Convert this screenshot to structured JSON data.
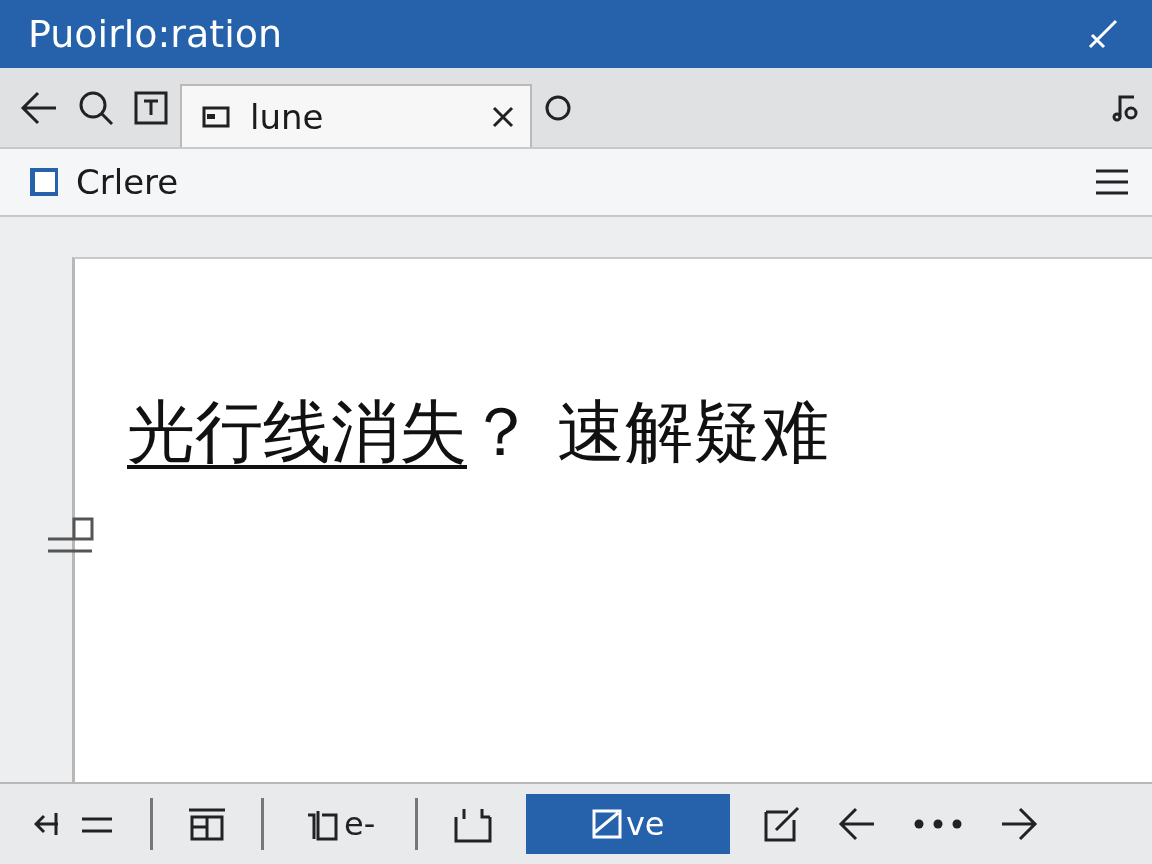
{
  "window": {
    "title": "Puoirlo:ration"
  },
  "tabs": [
    {
      "label": "lune",
      "selected": true
    }
  ],
  "address_bar": {
    "label": "Crlere"
  },
  "document": {
    "heading": [
      {
        "text": "光行线消失",
        "underline": true
      },
      {
        "text": "？ 速解疑难",
        "underline": false
      }
    ]
  },
  "bottom_toolbar": [
    {
      "kind": "icon"
    },
    {
      "kind": "separator"
    },
    {
      "kind": "icon"
    },
    {
      "kind": "separator"
    },
    {
      "kind": "labeled",
      "label": "e-",
      "selected": false
    },
    {
      "kind": "separator"
    },
    {
      "kind": "icon"
    },
    {
      "kind": "labeled",
      "label": "ve",
      "selected": true
    },
    {
      "kind": "icon"
    },
    {
      "kind": "icon"
    },
    {
      "kind": "icon"
    },
    {
      "kind": "icon"
    }
  ]
}
